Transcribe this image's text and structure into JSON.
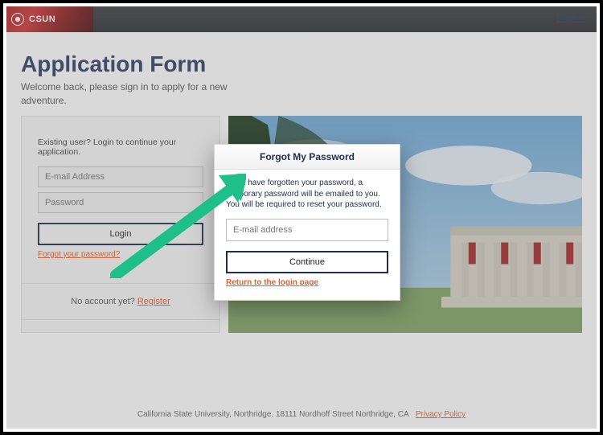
{
  "topbar": {
    "brand_text": "CSUN",
    "right_text": "English"
  },
  "page": {
    "title": "Application Form",
    "subtitle": "Welcome back, please sign in to apply for a new adventure."
  },
  "login": {
    "prompt": "Existing user? Login to continue your application.",
    "email_placeholder": "E-mail Address",
    "password_placeholder": "Password",
    "login_label": "Login",
    "forgot_label": "Forgot your password?"
  },
  "register": {
    "text": "No account yet?",
    "link": "Register"
  },
  "modal": {
    "title": "Forgot My Password",
    "message": "If you have forgotten your password, a temporary password will be emailed to you. You will be required to reset your password.",
    "email_placeholder": "E-mail address",
    "continue_label": "Continue",
    "return_label": "Return to the login page"
  },
  "footer": {
    "text": "California State University, Northridge. 18111 Nordhoff Street Northridge, CA",
    "privacy_label": "Privacy Policy"
  },
  "colors": {
    "accent": "#1e2d52",
    "link_orange": "#e35f2a",
    "arrow": "#1fbf8a"
  }
}
